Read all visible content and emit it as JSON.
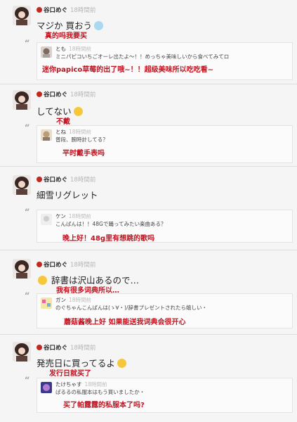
{
  "posts": [
    {
      "user": "谷口めぐ",
      "time": "18時間前",
      "text": "マジか 買おう",
      "emoji": "blob",
      "translation": "真的吗我要买",
      "reply": {
        "user": "とも",
        "time": "18時間前",
        "text": "ミニパピコいちごオーレ出たよ～！！めっちゃ美味しいから食べてみてロ",
        "translation": "迷你papico草莓的出了哦~！！超级美味所以吃吃看~"
      }
    },
    {
      "user": "谷口めぐ",
      "time": "18時間前",
      "text": "してない",
      "emoji": "smile",
      "translation": "不戴",
      "reply": {
        "user": "とね",
        "time": "18時間前",
        "text": "普段、腕時計してる？",
        "translation": "平时戴手表吗"
      }
    },
    {
      "user": "谷口めぐ",
      "time": "18時間前",
      "text": "細雪リグレット",
      "emoji": "",
      "translation": "",
      "reply": {
        "user": "ケン",
        "time": "18時間前",
        "text": "こんばんは！！48Gで踊ってみたい楽曲ある？",
        "translation": "晚上好！48g里有想跳的歌吗"
      }
    },
    {
      "user": "谷口めぐ",
      "time": "18時間前",
      "text": "辞書は沢山あるので…",
      "emoji": "smile",
      "translation": "我有很多词典所以…",
      "reply": {
        "user": "ガン",
        "time": "18時間前",
        "text": "のぐちゃんこんばんは(ゝ∀・)/辞書プレゼントされたら嬉しい・",
        "translation": "蘑菇酱晚上好 如果能送我词典会很开心"
      }
    },
    {
      "user": "谷口めぐ",
      "time": "18時間前",
      "text": "発売日に買ってるよ",
      "emoji": "smile",
      "translation": "发行日就买了",
      "reply": {
        "user": "たけちゃす",
        "time": "18時間前",
        "text": "ぱるるの私服本はもう買いましたか・",
        "translation": "买了帕露露的私服本了吗?"
      }
    }
  ],
  "colors": {
    "accent": "#c1121f",
    "lock": "#c02a1e"
  }
}
